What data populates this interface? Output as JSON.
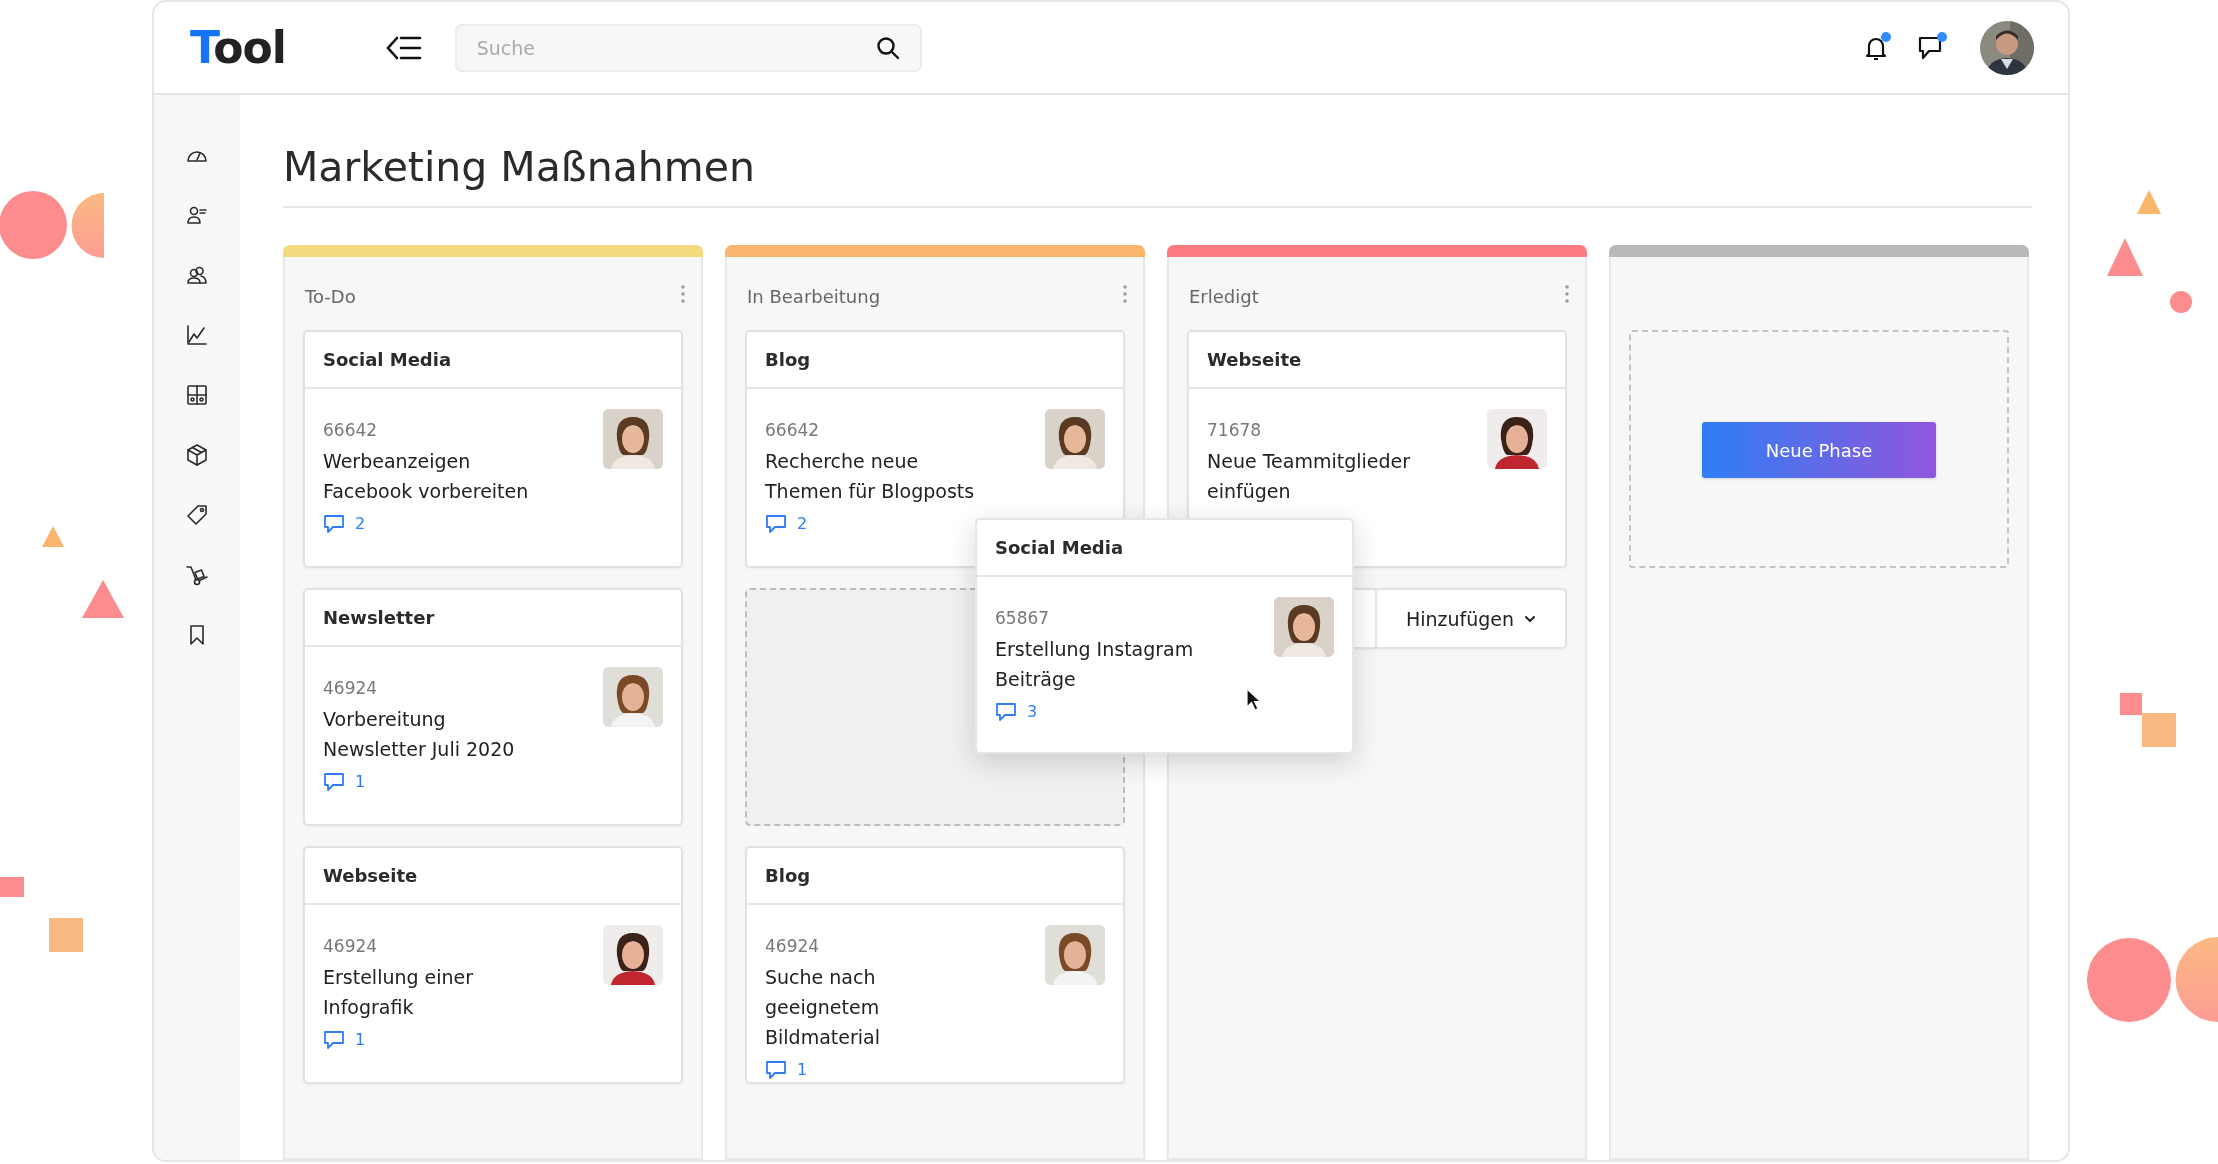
{
  "header": {
    "logo": "Tool",
    "search": {
      "placeholder": "Suche"
    },
    "notifications": {
      "unread": true
    },
    "messages": {
      "unread": true
    }
  },
  "page_title": "Marketing Maßnahmen",
  "columns": [
    {
      "title": "To-Do",
      "color": "#f4d97f",
      "items": [
        {
          "kind": "card",
          "category": "Social Media",
          "id": "66642",
          "title": "Werbeanzeigen Facebook vorbereiten",
          "comments": "2"
        },
        {
          "kind": "card",
          "category": "Newsletter",
          "id": "46924",
          "title": "Vorbereitung Newsletter Juli 2020",
          "comments": "1"
        },
        {
          "kind": "card",
          "category": "Webseite",
          "id": "46924",
          "title": "Erstellung einer Infografik",
          "comments": "1"
        }
      ]
    },
    {
      "title": "In Bearbeitung",
      "color": "#fbb46c",
      "items": [
        {
          "kind": "card",
          "category": "Blog",
          "id": "66642",
          "title": "Recherche neue Themen für Blogposts",
          "comments": "2"
        },
        {
          "kind": "drop-zone"
        },
        {
          "kind": "card",
          "category": "Blog",
          "id": "46924",
          "title": "Suche nach geeignetem Bildmaterial",
          "comments": "1"
        }
      ]
    },
    {
      "title": "Erledigt",
      "color": "#fd7b80",
      "items": [
        {
          "kind": "card",
          "category": "Webseite",
          "id": "71678",
          "title": "Neue Teammitglieder einfügen"
        },
        {
          "kind": "add-button",
          "label": "Hinzufügen"
        }
      ]
    },
    {
      "color": "#b9b9b9",
      "items": [
        {
          "kind": "new-phase",
          "label": "Neue Phase"
        }
      ]
    }
  ],
  "dragged_card": {
    "category": "Social Media",
    "id": "65867",
    "title": "Erstellung Instagram Beiträge",
    "comments": "3"
  }
}
